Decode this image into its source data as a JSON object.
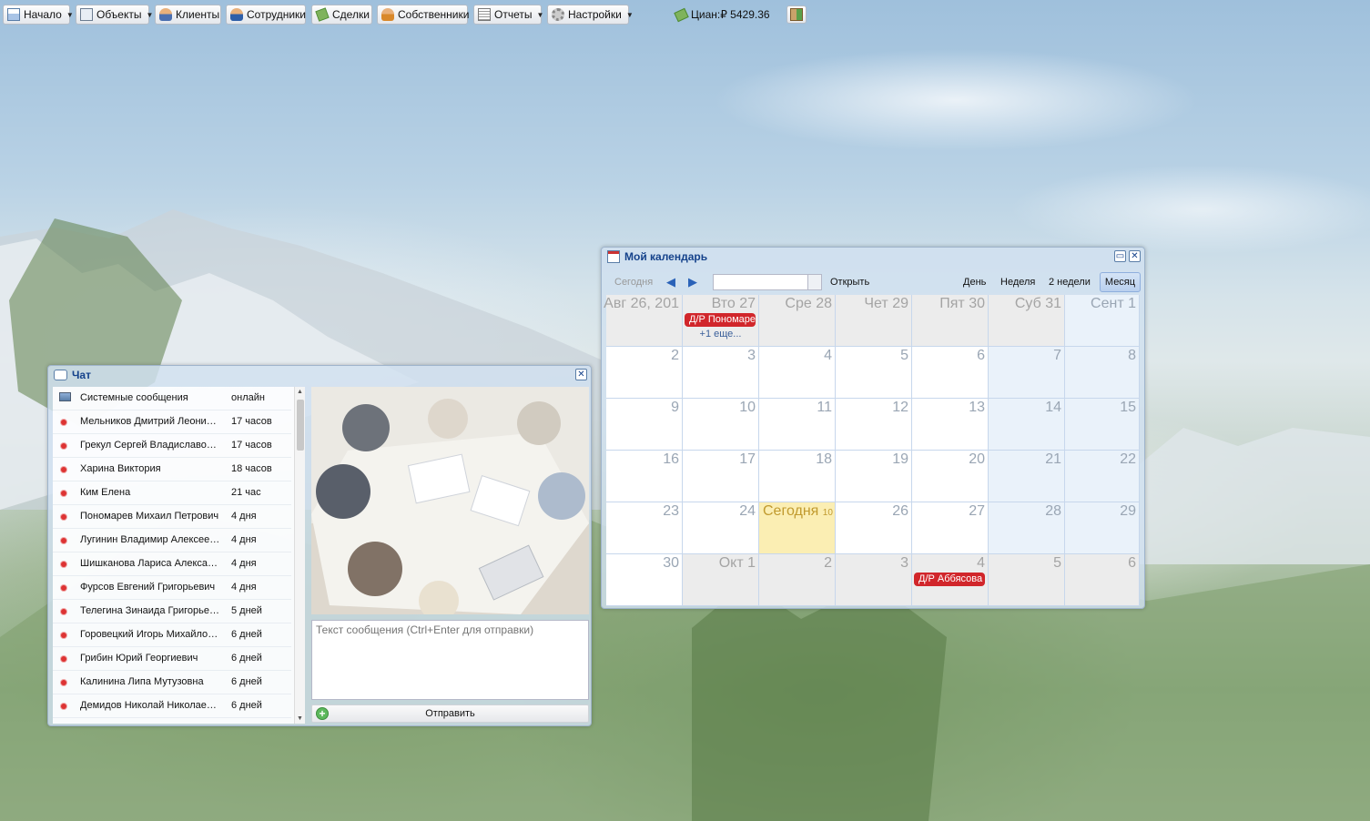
{
  "toolbar": {
    "items": [
      {
        "label": "Начало",
        "menu": true
      },
      {
        "label": "Объекты",
        "menu": true
      },
      {
        "label": "Клиенты",
        "menu": false
      },
      {
        "label": "Сотрудники",
        "menu": false
      },
      {
        "label": "Сделки",
        "menu": false
      },
      {
        "label": "Собственники",
        "menu": false
      },
      {
        "label": "Отчеты",
        "menu": true
      },
      {
        "label": "Настройки",
        "menu": true
      }
    ],
    "cian_balance": "Циан:₽ 5429.36",
    "icons": [
      "home-icon",
      "objects-icon",
      "clients-icon",
      "employees-icon",
      "deals-icon",
      "owners-icon",
      "reports-icon",
      "settings-icon",
      "cian-icon",
      "exit-icon"
    ]
  },
  "chat": {
    "title": "Чат",
    "contacts": [
      {
        "name": "Системные сообщения",
        "time": "онлайн"
      },
      {
        "name": "Мельников Дмитрий Леонидович",
        "time": "17 часов"
      },
      {
        "name": "Грекул Сергей Владиславович",
        "time": "17 часов"
      },
      {
        "name": "Харина Виктория",
        "time": "18 часов"
      },
      {
        "name": "Ким Елена",
        "time": "21 час"
      },
      {
        "name": "Пономарев Михаил Петрович",
        "time": "4 дня"
      },
      {
        "name": "Лугинин Владимир Алексеевич",
        "time": "4 дня"
      },
      {
        "name": "Шишканова Лариса Александровна",
        "time": "4 дня"
      },
      {
        "name": "Фурсов Евгений Григорьевич",
        "time": "4 дня"
      },
      {
        "name": "Телегина Зинаида Григорьевна",
        "time": "5 дней"
      },
      {
        "name": "Горовецкий Игорь Михайлович",
        "time": "6 дней"
      },
      {
        "name": "Грибин Юрий Георгиевич",
        "time": "6 дней"
      },
      {
        "name": "Калинина Липа Мутузовна",
        "time": "6 дней"
      },
      {
        "name": "Демидов Николай Николаевич",
        "time": "6 дней"
      }
    ],
    "message_placeholder": "Текст сообщения (Ctrl+Enter для отправки)",
    "send_label": "Отправить"
  },
  "calendar": {
    "title": "Мой календарь",
    "today_label": "Сегодня",
    "open_label": "Открыть",
    "date_value": "",
    "views": {
      "day": "День",
      "week": "Неделя",
      "two_weeks": "2 недели",
      "month": "Месяц"
    },
    "active_view": "Месяц",
    "weeks": [
      [
        {
          "label": "Авг 26, 201",
          "type": "off"
        },
        {
          "label": "Вто 27",
          "type": "off",
          "event": "Д/Р Пономаре",
          "more": "+1 еще..."
        },
        {
          "label": "Сре 28",
          "type": "off"
        },
        {
          "label": "Чет 29",
          "type": "off"
        },
        {
          "label": "Пят 30",
          "type": "off"
        },
        {
          "label": "Суб 31",
          "type": "off"
        },
        {
          "label": "Сент 1",
          "type": "wk"
        }
      ],
      [
        {
          "label": "2",
          "type": ""
        },
        {
          "label": "3",
          "type": ""
        },
        {
          "label": "4",
          "type": ""
        },
        {
          "label": "5",
          "type": ""
        },
        {
          "label": "6",
          "type": ""
        },
        {
          "label": "7",
          "type": "wk"
        },
        {
          "label": "8",
          "type": "wk"
        }
      ],
      [
        {
          "label": "9",
          "type": ""
        },
        {
          "label": "10",
          "type": ""
        },
        {
          "label": "11",
          "type": ""
        },
        {
          "label": "12",
          "type": ""
        },
        {
          "label": "13",
          "type": ""
        },
        {
          "label": "14",
          "type": "wk"
        },
        {
          "label": "15",
          "type": "wk"
        }
      ],
      [
        {
          "label": "16",
          "type": ""
        },
        {
          "label": "17",
          "type": ""
        },
        {
          "label": "18",
          "type": ""
        },
        {
          "label": "19",
          "type": ""
        },
        {
          "label": "20",
          "type": ""
        },
        {
          "label": "21",
          "type": "wk"
        },
        {
          "label": "22",
          "type": "wk"
        }
      ],
      [
        {
          "label": "23",
          "type": ""
        },
        {
          "label": "24",
          "type": ""
        },
        {
          "label": "Сегодня",
          "sub": "10",
          "type": "today"
        },
        {
          "label": "26",
          "type": ""
        },
        {
          "label": "27",
          "type": ""
        },
        {
          "label": "28",
          "type": "wk"
        },
        {
          "label": "29",
          "type": "wk"
        }
      ],
      [
        {
          "label": "30",
          "type": ""
        },
        {
          "label": "Окт 1",
          "type": "off"
        },
        {
          "label": "2",
          "type": "off"
        },
        {
          "label": "3",
          "type": "off"
        },
        {
          "label": "4",
          "type": "off",
          "event": "Д/Р Аббясова"
        },
        {
          "label": "5",
          "type": "off"
        },
        {
          "label": "6",
          "type": "off"
        }
      ]
    ]
  },
  "colors": {
    "window_title": "#15428b",
    "event": "#d1262b",
    "today": "#fbeeb3",
    "weekend": "#eaf2fa"
  }
}
